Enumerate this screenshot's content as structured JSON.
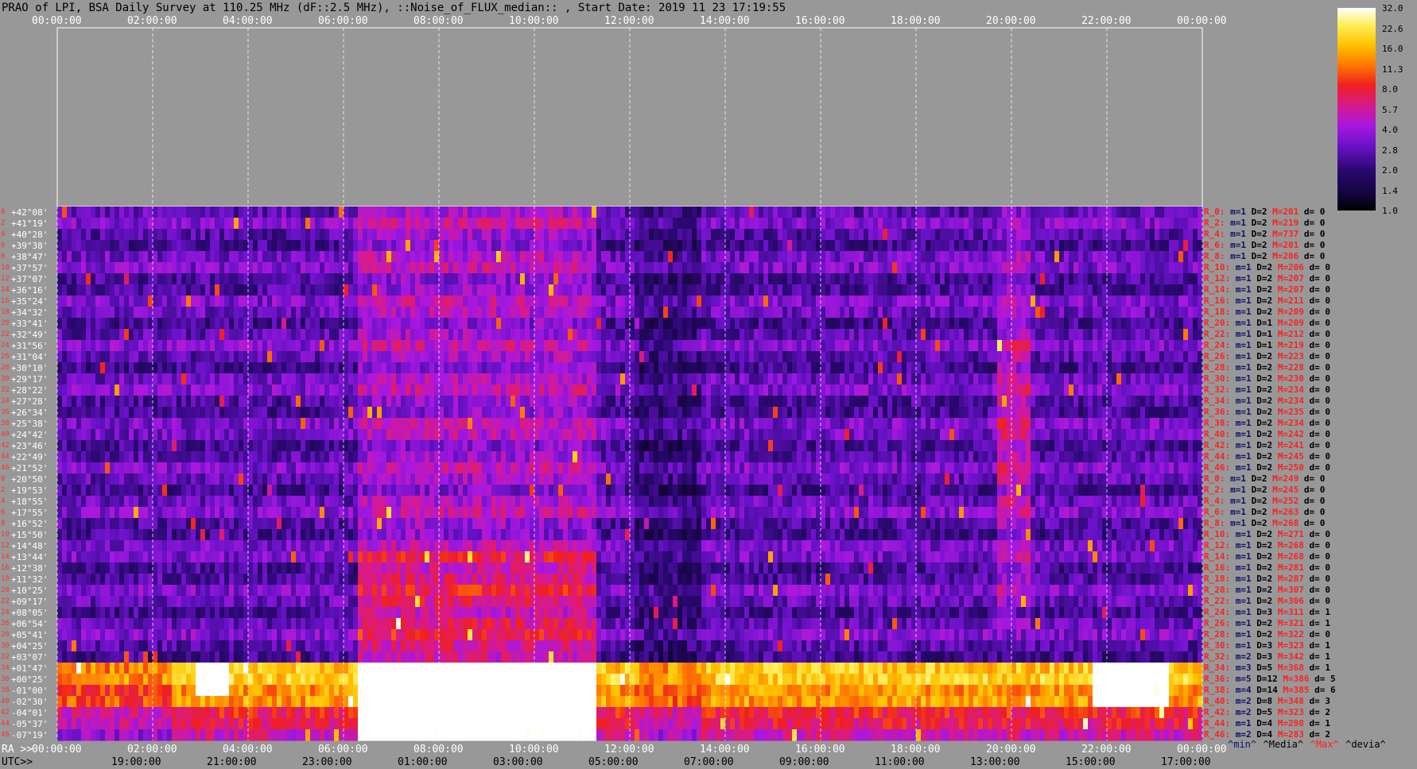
{
  "title": "PRAO of LPI, BSA Daily Survey at 110.25 MHz (dF::2.5 MHz), ::Noise_of_FLUX_median:: , Start Date: 2019 11 23 17:19:55",
  "chart_data": {
    "type": "heatmap",
    "x_top_ticks": [
      "00:00:00",
      "02:00:00",
      "04:00:00",
      "06:00:00",
      "08:00:00",
      "10:00:00",
      "12:00:00",
      "14:00:00",
      "16:00:00",
      "18:00:00",
      "20:00:00",
      "22:00:00",
      "00:00:00"
    ],
    "x_bottom_ra_lead": "RA >>",
    "x_bottom_ra_ticks": [
      "00:00:00",
      "02:00:00",
      "04:00:00",
      "06:00:00",
      "08:00:00",
      "10:00:00",
      "12:00:00",
      "14:00:00",
      "16:00:00",
      "18:00:00",
      "20:00:00",
      "22:00:00",
      "00:00:00"
    ],
    "x_bottom_utc_lead": "UTC>>",
    "x_bottom_utc_ticks": [
      "19:00:00",
      "21:00:00",
      "23:00:00",
      "01:00:00",
      "03:00:00",
      "05:00:00",
      "07:00:00",
      "09:00:00",
      "11:00:00",
      "13:00:00",
      "15:00:00",
      "17:00:00"
    ],
    "y_labels": [
      "+42°08'",
      "+41°19'",
      "+40°28'",
      "+39°38'",
      "+38°47'",
      "+37°57'",
      "+37°07'",
      "+36°16'",
      "+35°24'",
      "+34°32'",
      "+33°41'",
      "+32°49'",
      "+31°56'",
      "+31°04'",
      "+30°10'",
      "+29°17'",
      "+28°22'",
      "+27°28'",
      "+26°34'",
      "+25°38'",
      "+24°42'",
      "+23°46'",
      "+22°49'",
      "+21°52'",
      "+20°50'",
      "+19°53'",
      "+18°55'",
      "+17°55'",
      "+16°52'",
      "+15°50'",
      "+14°48'",
      "+13°44'",
      "+12°38'",
      "+11°32'",
      "+10°25'",
      "+09°17'",
      "+08°05'",
      "+06°54'",
      "+05°41'",
      "+04°25'",
      "+03°07'",
      "+01°47'",
      "+00°25'",
      "-01°00'",
      "-02°30'",
      "-04°01'",
      "-05°37'",
      "-07°19'"
    ],
    "row_indices": [
      "0",
      "2",
      "4",
      "6",
      "8",
      "10",
      "12",
      "14",
      "16",
      "18",
      "20",
      "22",
      "24",
      "26",
      "28",
      "30",
      "32",
      "34",
      "36",
      "38",
      "40",
      "42",
      "44",
      "46",
      "0",
      "2",
      "4",
      "6",
      "8",
      "10",
      "12",
      "14",
      "16",
      "18",
      "20",
      "22",
      "24",
      "26",
      "28",
      "30",
      "32",
      "34",
      "36",
      "38",
      "40",
      "42",
      "44",
      "46"
    ],
    "colorbar": {
      "scale": "log",
      "ticks": [
        "32.0",
        "22.6",
        "16.0",
        "11.3",
        "8.0",
        "5.7",
        "4.0",
        "2.8",
        "2.0",
        "1.4",
        "1.0"
      ],
      "range": [
        1.0,
        32.0
      ]
    },
    "row_stats": [
      {
        "name": "R_0:",
        "min": "m=1",
        "D": "D=2",
        "max": "M=201",
        "dev": "d= 0"
      },
      {
        "name": "R_2:",
        "min": "m=1",
        "D": "D=2",
        "max": "M=219",
        "dev": "d= 0"
      },
      {
        "name": "R_4:",
        "min": "m=1",
        "D": "D=2",
        "max": "M=737",
        "dev": "d= 0"
      },
      {
        "name": "R_6:",
        "min": "m=1",
        "D": "D=2",
        "max": "M=201",
        "dev": "d= 0"
      },
      {
        "name": "R_8:",
        "min": "m=1",
        "D": "D=2",
        "max": "M=206",
        "dev": "d= 0"
      },
      {
        "name": "R_10:",
        "min": "m=1",
        "D": "D=2",
        "max": "M=206",
        "dev": "d= 0"
      },
      {
        "name": "R_12:",
        "min": "m=1",
        "D": "D=2",
        "max": "M=207",
        "dev": "d= 0"
      },
      {
        "name": "R_14:",
        "min": "m=1",
        "D": "D=2",
        "max": "M=207",
        "dev": "d= 0"
      },
      {
        "name": "R_16:",
        "min": "m=1",
        "D": "D=2",
        "max": "M=211",
        "dev": "d= 0"
      },
      {
        "name": "R_18:",
        "min": "m=1",
        "D": "D=2",
        "max": "M=209",
        "dev": "d= 0"
      },
      {
        "name": "R_20:",
        "min": "m=1",
        "D": "D=1",
        "max": "M=209",
        "dev": "d= 0"
      },
      {
        "name": "R_22:",
        "min": "m=1",
        "D": "D=1",
        "max": "M=212",
        "dev": "d= 0"
      },
      {
        "name": "R_24:",
        "min": "m=1",
        "D": "D=1",
        "max": "M=219",
        "dev": "d= 0"
      },
      {
        "name": "R_26:",
        "min": "m=1",
        "D": "D=2",
        "max": "M=223",
        "dev": "d= 0"
      },
      {
        "name": "R_28:",
        "min": "m=1",
        "D": "D=2",
        "max": "M=228",
        "dev": "d= 0"
      },
      {
        "name": "R_30:",
        "min": "m=1",
        "D": "D=2",
        "max": "M=230",
        "dev": "d= 0"
      },
      {
        "name": "R_32:",
        "min": "m=1",
        "D": "D=2",
        "max": "M=234",
        "dev": "d= 0"
      },
      {
        "name": "R_34:",
        "min": "m=1",
        "D": "D=2",
        "max": "M=234",
        "dev": "d= 0"
      },
      {
        "name": "R_36:",
        "min": "m=1",
        "D": "D=2",
        "max": "M=235",
        "dev": "d= 0"
      },
      {
        "name": "R_38:",
        "min": "m=1",
        "D": "D=2",
        "max": "M=234",
        "dev": "d= 0"
      },
      {
        "name": "R_40:",
        "min": "m=1",
        "D": "D=2",
        "max": "M=242",
        "dev": "d= 0"
      },
      {
        "name": "R_42:",
        "min": "m=1",
        "D": "D=2",
        "max": "M=241",
        "dev": "d= 0"
      },
      {
        "name": "R_44:",
        "min": "m=1",
        "D": "D=2",
        "max": "M=245",
        "dev": "d= 0"
      },
      {
        "name": "R_46:",
        "min": "m=1",
        "D": "D=2",
        "max": "M=250",
        "dev": "d= 0"
      },
      {
        "name": "R_0:",
        "min": "m=1",
        "D": "D=2",
        "max": "M=249",
        "dev": "d= 0"
      },
      {
        "name": "R_2:",
        "min": "m=1",
        "D": "D=2",
        "max": "M=245",
        "dev": "d= 0"
      },
      {
        "name": "R_4:",
        "min": "m=1",
        "D": "D=2",
        "max": "M=252",
        "dev": "d= 0"
      },
      {
        "name": "R_6:",
        "min": "m=1",
        "D": "D=2",
        "max": "M=263",
        "dev": "d= 0"
      },
      {
        "name": "R_8:",
        "min": "m=1",
        "D": "D=2",
        "max": "M=268",
        "dev": "d= 0"
      },
      {
        "name": "R_10:",
        "min": "m=1",
        "D": "D=2",
        "max": "M=271",
        "dev": "d= 0"
      },
      {
        "name": "R_12:",
        "min": "m=1",
        "D": "D=2",
        "max": "M=268",
        "dev": "d= 0"
      },
      {
        "name": "R_14:",
        "min": "m=1",
        "D": "D=2",
        "max": "M=268",
        "dev": "d= 0"
      },
      {
        "name": "R_16:",
        "min": "m=1",
        "D": "D=2",
        "max": "M=281",
        "dev": "d= 0"
      },
      {
        "name": "R_18:",
        "min": "m=1",
        "D": "D=2",
        "max": "M=287",
        "dev": "d= 0"
      },
      {
        "name": "R_20:",
        "min": "m=1",
        "D": "D=2",
        "max": "M=307",
        "dev": "d= 0"
      },
      {
        "name": "R_22:",
        "min": "m=1",
        "D": "D=2",
        "max": "M=306",
        "dev": "d= 0"
      },
      {
        "name": "R_24:",
        "min": "m=1",
        "D": "D=3",
        "max": "M=311",
        "dev": "d= 1"
      },
      {
        "name": "R_26:",
        "min": "m=1",
        "D": "D=2",
        "max": "M=321",
        "dev": "d= 1"
      },
      {
        "name": "R_28:",
        "min": "m=1",
        "D": "D=2",
        "max": "M=322",
        "dev": "d= 0"
      },
      {
        "name": "R_30:",
        "min": "m=1",
        "D": "D=3",
        "max": "M=323",
        "dev": "d= 1"
      },
      {
        "name": "R_32:",
        "min": "m=2",
        "D": "D=3",
        "max": "M=342",
        "dev": "d= 1"
      },
      {
        "name": "R_34:",
        "min": "m=3",
        "D": "D=5",
        "max": "M=368",
        "dev": "d= 1"
      },
      {
        "name": "R_36:",
        "min": "m=5",
        "D": "D=12",
        "max": "M=386",
        "dev": "d= 5"
      },
      {
        "name": "R_38:",
        "min": "m=4",
        "D": "D=14",
        "max": "M=385",
        "dev": "d= 6"
      },
      {
        "name": "R_40:",
        "min": "m=2",
        "D": "D=8",
        "max": "M=348",
        "dev": "d= 3"
      },
      {
        "name": "R_42:",
        "min": "m=2",
        "D": "D=5",
        "max": "M=323",
        "dev": "d= 2"
      },
      {
        "name": "R_44:",
        "min": "m=1",
        "D": "D=4",
        "max": "M=298",
        "dev": "d= 1"
      },
      {
        "name": "R_46:",
        "min": "m=2",
        "D": "D=4",
        "max": "M=283",
        "dev": "d= 2"
      }
    ],
    "legend": [
      {
        "text": "^min^",
        "color": "#10106a"
      },
      {
        "text": "^Media^",
        "color": "#000000"
      },
      {
        "text": "^Max^",
        "color": "#ff2020"
      },
      {
        "text": "^devia^",
        "color": "#000000"
      }
    ],
    "grid": true
  }
}
